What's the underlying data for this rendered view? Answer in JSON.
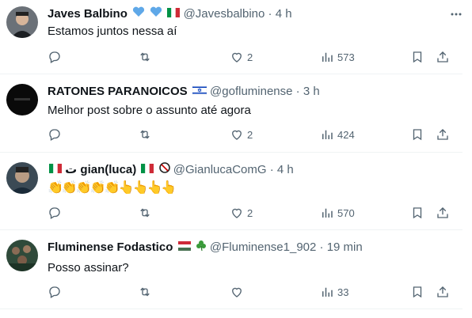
{
  "tweets": [
    {
      "name": "Javes Balbino",
      "name_emojis": [
        "blue-heart",
        "blue-heart",
        "italy-flag"
      ],
      "handle": "@Javesbalbino",
      "time": "4 h",
      "text": "Estamos juntos nessa aí",
      "replies": "",
      "retweets": "",
      "likes": "2",
      "views": "573"
    },
    {
      "name": "RATONES PARANOICOS",
      "name_emojis": [
        "israel-flag"
      ],
      "handle": "@gofluminense",
      "time": "3 h",
      "text": "Melhor post sobre o assunto até agora",
      "replies": "",
      "retweets": "",
      "likes": "2",
      "views": "424"
    },
    {
      "name_prefix_emojis": [
        "italy-flag"
      ],
      "name": "ت gian(luca)",
      "name_emojis": [
        "italy-flag",
        "no-entry"
      ],
      "handle": "@GianlucaComG",
      "time": "4 h",
      "text": "👏👏👏👏👏👆👆👆👆",
      "replies": "",
      "retweets": "",
      "likes": "2",
      "views": "570"
    },
    {
      "name": "Fluminense Fodastico",
      "name_emojis": [
        "hungary-flag",
        "shamrock"
      ],
      "handle": "@Fluminense1_902",
      "time": "19 min",
      "text": "Posso assinar?",
      "replies": "",
      "retweets": "",
      "likes": "",
      "views": "33"
    }
  ],
  "dot": "·",
  "colors": {
    "text": "#0f1419",
    "secondary": "#536471",
    "divider": "#eff3f4"
  }
}
